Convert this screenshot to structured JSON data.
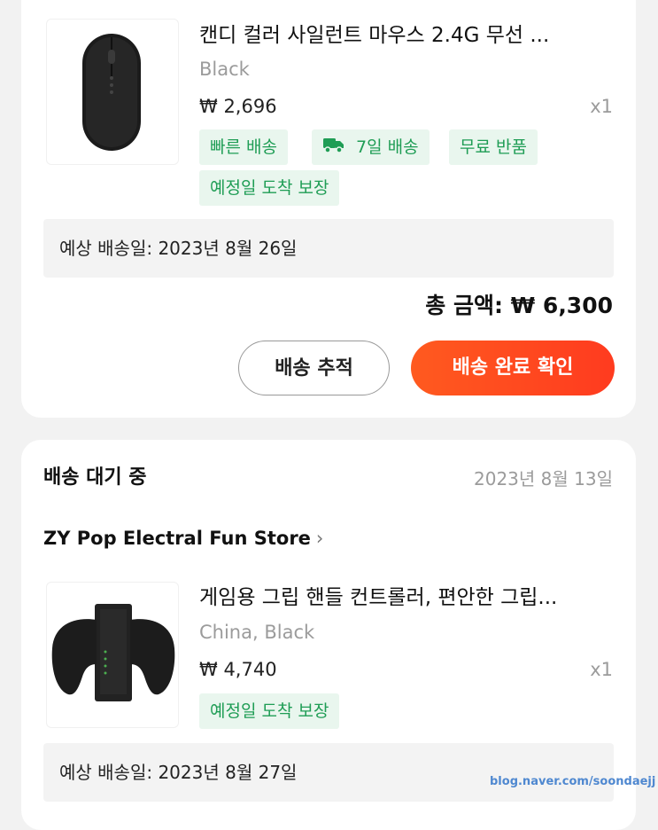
{
  "orders": [
    {
      "item": {
        "title": "캔디 컬러 사일런트 마우스 2.4G 무선 ...",
        "variant": "Black",
        "price": "₩ 2,696",
        "qty": "x1",
        "tags": [
          "빠른 배송",
          "7일 배송",
          "무료 반품",
          "예정일 도착 보장"
        ]
      },
      "delivery": "예상 배송일: 2023년 8월 26일",
      "total": "총 금액: ₩ 6,300",
      "buttons": {
        "track": "배송 추적",
        "confirm": "배송 완료 확인"
      }
    },
    {
      "status": "배송 대기 중",
      "date": "2023년 8월 13일",
      "store": "ZY Pop Electral Fun Store",
      "item": {
        "title": "게임용 그립 핸들 컨트롤러, 편안한 그립...",
        "variant": "China, Black",
        "price": "₩ 4,740",
        "qty": "x1",
        "tags": [
          "예정일 도착 보장"
        ]
      },
      "delivery": "예상 배송일: 2023년 8월 27일"
    }
  ],
  "watermark": "blog.naver.com/soondaejj",
  "colors": {
    "accent": "#ff4a1f",
    "tag_text": "#1f9d55",
    "tag_bg": "#e9f6ee"
  },
  "icons": [
    "truck-icon",
    "chevron-right-icon"
  ]
}
